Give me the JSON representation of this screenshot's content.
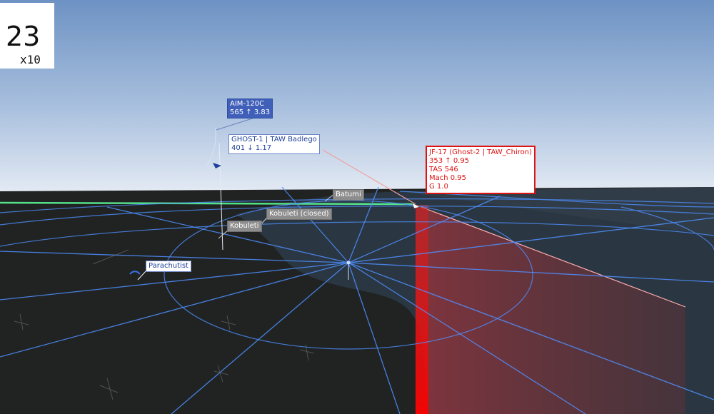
{
  "counter": {
    "value": "23",
    "multiplier": "x10"
  },
  "labels": {
    "missile": {
      "line1": "AIM-120C",
      "line2": "565 ↑ 3.83"
    },
    "ghost1": {
      "line1": "GHOST-1 | TAW Badlego",
      "line2": "401 ↓ 1.17"
    },
    "parachutist": "Parachutist",
    "batumi": "Batumi",
    "kobuleti_closed": "Kobuleti (closed)",
    "kobuleti": "Kobuleti",
    "target": {
      "line1": "JF-17 (Ghost-2 | TAW_Chiron)",
      "line2": "353 ↑ 0.95",
      "line3": "TAS 546",
      "line4": "Mach 0.95",
      "line5": "G 1.0"
    }
  },
  "colors": {
    "sky_top": "#6f93c4",
    "sky_horizon": "#e4eaf4",
    "grid": "#4f8fff",
    "friendly": "#3f5fb8",
    "enemy": "#e01313",
    "horizon_line": "#55e08a"
  }
}
